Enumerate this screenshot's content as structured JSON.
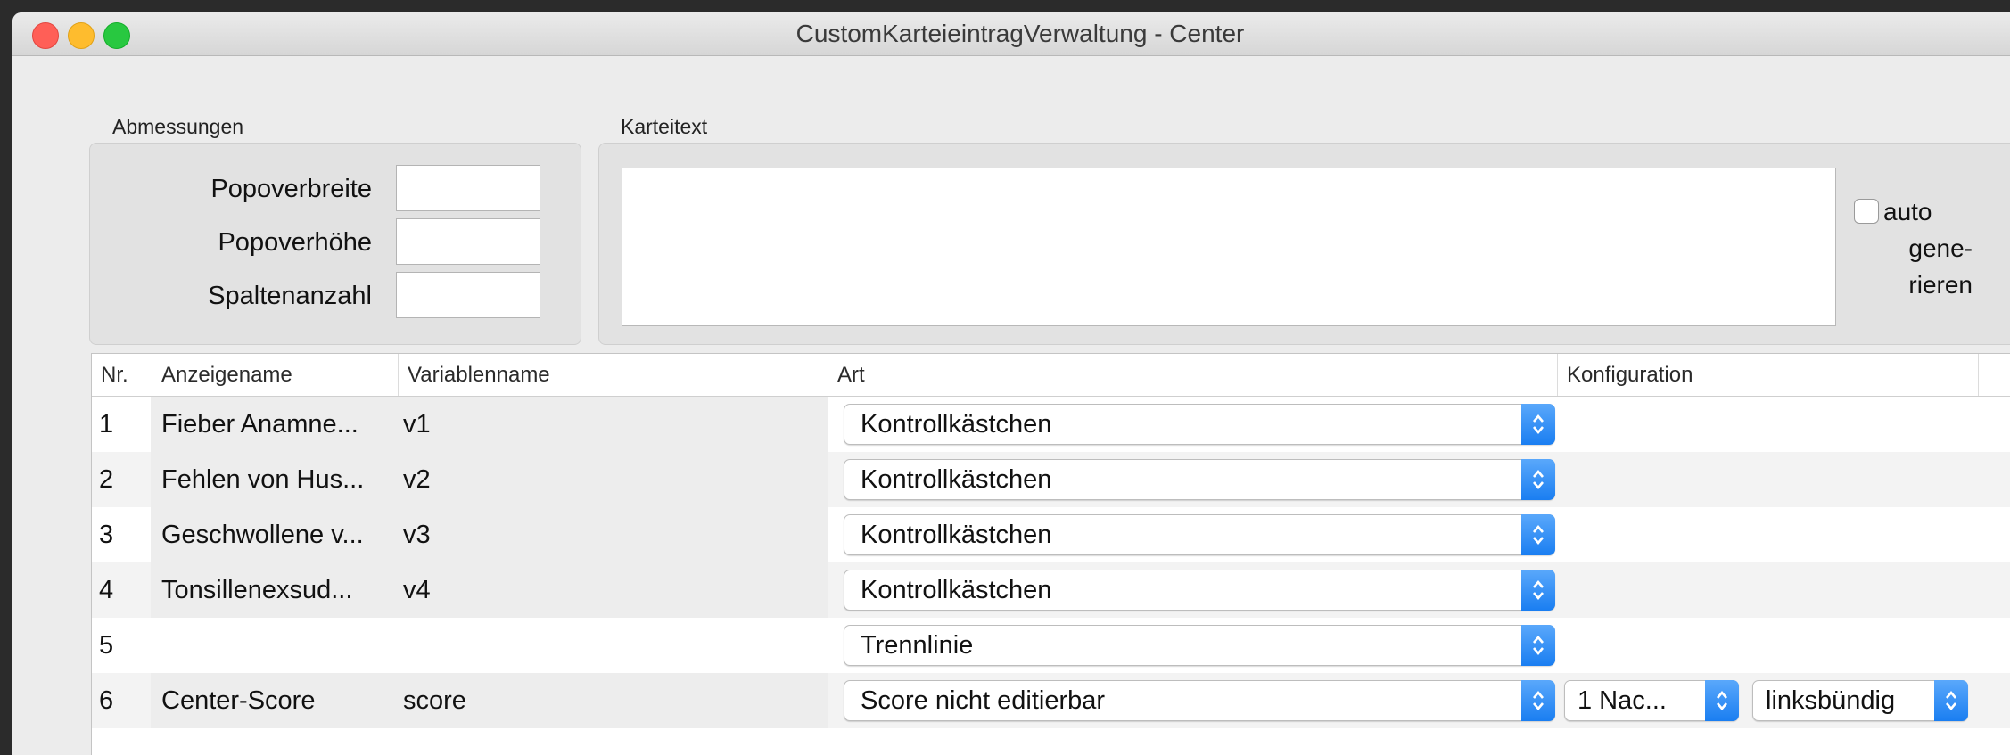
{
  "window": {
    "title": "CustomKarteieintragVerwaltung - Center"
  },
  "abmessungen": {
    "label": "Abmessungen",
    "fields": [
      {
        "label": "Popoverbreite",
        "value": ""
      },
      {
        "label": "Popoverhöhe",
        "value": ""
      },
      {
        "label": "Spaltenanzahl",
        "value": ""
      }
    ]
  },
  "karteitext": {
    "label": "Karteitext",
    "value": "",
    "auto_checkbox": {
      "lines": [
        "auto",
        "gene-",
        "rieren"
      ],
      "checked": false
    }
  },
  "table": {
    "columns": [
      "Nr.",
      "Anzeigename",
      "Variablenname",
      "Art",
      "Konfiguration"
    ],
    "rows": [
      {
        "nr": "1",
        "anzeigename": "Fieber Anamne...",
        "variablenname": "v1",
        "art": "Kontrollkästchen"
      },
      {
        "nr": "2",
        "anzeigename": "Fehlen von Hus...",
        "variablenname": "v2",
        "art": "Kontrollkästchen"
      },
      {
        "nr": "3",
        "anzeigename": "Geschwollene v...",
        "variablenname": "v3",
        "art": "Kontrollkästchen"
      },
      {
        "nr": "4",
        "anzeigename": "Tonsillenexsud...",
        "variablenname": "v4",
        "art": "Kontrollkästchen"
      },
      {
        "nr": "5",
        "anzeigename": "",
        "variablenname": "",
        "art": "Trennlinie"
      },
      {
        "nr": "6",
        "anzeigename": "Center-Score",
        "variablenname": "score",
        "art": "Score nicht editierbar",
        "konfiguration": [
          "1 Nac...",
          "linksbündig"
        ]
      }
    ]
  },
  "colors": {
    "accent": "#1a7ef1",
    "close": "#ff5f57",
    "minimize": "#febc2e",
    "maximize": "#28c840"
  },
  "icons": {
    "popup_indicator": "up-down-chevron-icon"
  }
}
